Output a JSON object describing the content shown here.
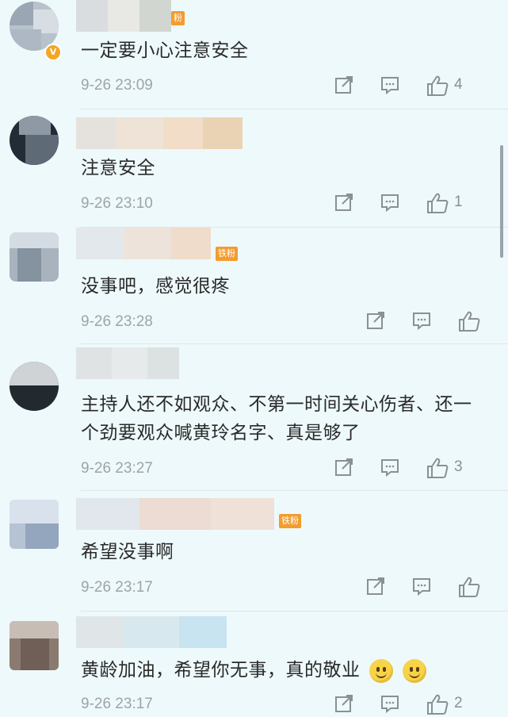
{
  "fan_badge": "铁粉",
  "comments": [
    {
      "text": "一定要小心注意安全",
      "time": "9-26 23:09",
      "likes": "4"
    },
    {
      "text": "注意安全",
      "time": "9-26 23:10",
      "likes": "1"
    },
    {
      "text": "没事吧，感觉很疼",
      "time": "9-26 23:28",
      "likes": ""
    },
    {
      "text": "主持人还不如观众、不第一时间关心伤者、还一个劲要观众喊黄玲名字、真是够了",
      "time": "9-26 23:27",
      "likes": "3"
    },
    {
      "text": "希望没事啊",
      "time": "9-26 23:17",
      "likes": ""
    },
    {
      "text": "黄龄加油，希望你无事，真的敬业",
      "time": "9-26 23:17",
      "likes": "2"
    }
  ],
  "icons": {
    "share": "share-icon",
    "reply": "comment-icon",
    "like": "thumbs-up-icon",
    "emoji": "smiley-emoji-icon",
    "verified": "verified-badge-icon"
  },
  "colors": {
    "background": "#eef9fb",
    "text": "#2a2a2a",
    "meta": "#9ea4a8",
    "badge": "#f39c2f"
  }
}
